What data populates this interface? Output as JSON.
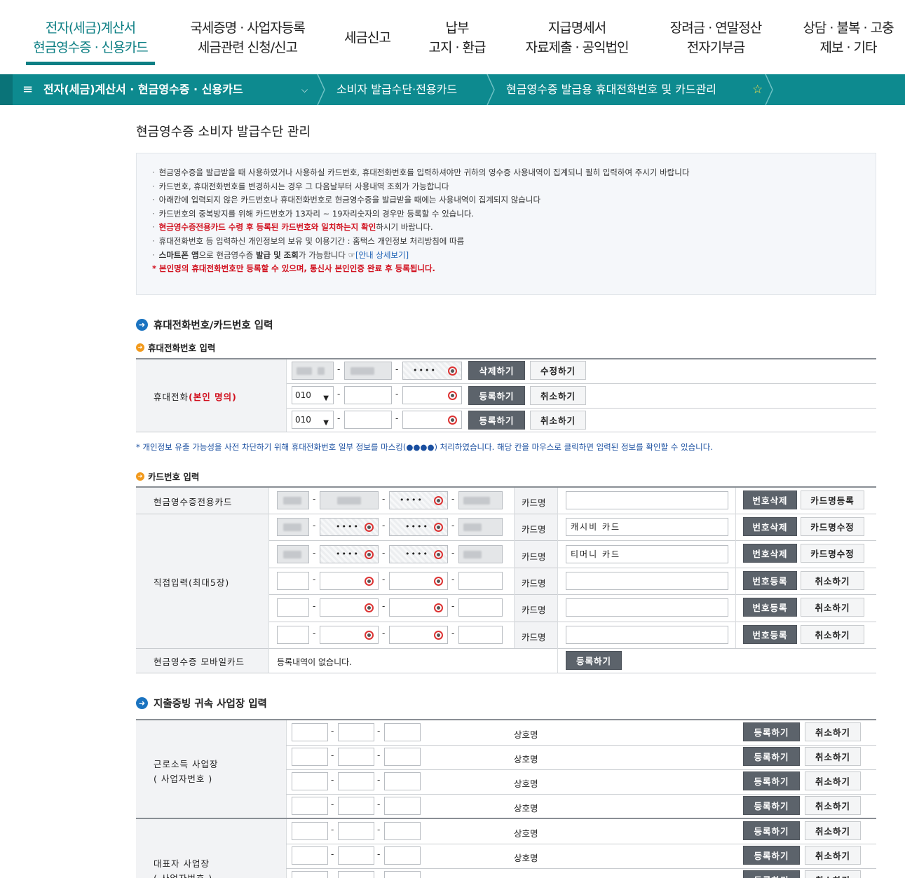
{
  "topnav": {
    "items": [
      {
        "line1": "전자(세금)계산서",
        "line2": "현금영수증 · 신용카드"
      },
      {
        "line1": "국세증명 · 사업자등록",
        "line2": "세금관련 신청/신고"
      },
      {
        "line1": "세금신고",
        "line2": ""
      },
      {
        "line1": "납부",
        "line2": "고지 · 환급"
      },
      {
        "line1": "지급명세서",
        "line2": "자료제출 · 공익법인"
      },
      {
        "line1": "장려금 · 연말정산",
        "line2": "전자기부금"
      },
      {
        "line1": "상담 · 불복 · 고충",
        "line2": "제보 · 기타"
      }
    ],
    "accent": "#0d7f84"
  },
  "breadcrumb": {
    "menu_icon": "≡",
    "level1": "전자(세금)계산서 · 현금영수증 · 신용카드",
    "level2": "소비자 발급수단·전용카드",
    "level3": "현금영수증 발급용 휴대전화번호 및 카드관리",
    "star": "☆",
    "bar_color": "#0d8a8f"
  },
  "page_title": "현금영수증 소비자 발급수단 관리",
  "notice": {
    "lines": [
      "현금영수증을 발급받을 때 사용하였거나 사용하실 카드번호, 휴대전화번호를 입력하셔야만 귀하의 영수증 사용내역이 집계되니 필히 입력하여 주시기 바랍니다",
      "카드번호, 휴대전화번호를 변경하시는 경우 그 다음날부터 사용내역 조회가 가능합니다",
      "아래칸에 입력되지 않은 카드번호나 휴대전화번호로 현금영수증을 발급받을 때에는 사용내역이 집계되지 않습니다",
      "카드번호의 중복방지를 위해 카드번호가 13자리 ~ 19자리숫자의 경우만 등록할 수 있습니다."
    ],
    "line5_red": "현금영수증전용카드 수령 후 등록된 카드번호와 일치하는지 확인",
    "line5_rest": "하시기 바랍니다.",
    "line6": "휴대전화번호 등 입력하신 개인정보의 보유 및 이용기간 : 홈택스 개인정보 처리방침에 따름",
    "line7_bold1": "스마트폰 앱",
    "line7_mid": "으로 현금영수증 ",
    "line7_bold2": "발급 및 조회",
    "line7_rest": "가 가능합니다 ☞",
    "line7_link": "[안내 상세보기]",
    "line8": "* 본인명의 휴대전화번호만 등록할 수 있으며, 통신사 본인인증 완료 후 등록됩니다."
  },
  "section1": {
    "title": "휴대전화번호/카드번호 입력",
    "phone_subtitle": "휴대전화번호 입력",
    "phone_label": "휴대전화",
    "phone_label_red": "(본인 명의)",
    "phone_prefix": "010",
    "phone_mask": "••••",
    "btn_delete": "삭제하기",
    "btn_edit": "수정하기",
    "btn_register": "등록하기",
    "btn_cancel": "취소하기",
    "hint": "* 개인정보 유출 가능성을 사전 차단하기 위해 휴대전화번호 일부 정보를 마스킹(●●●●) 처리하였습니다. 해당 칸을 마우스로 클릭하면 입력된 정보를 확인할 수 있습니다.",
    "card_subtitle": "카드번호 입력",
    "card_rows": {
      "dedicated_label": "현금영수증전용카드",
      "direct_label": "직접입력(최대5장)",
      "mobile_label": "현금영수증 모바일카드",
      "card_name_label": "카드명",
      "mask": "••••",
      "card1_name": "캐시비 카드",
      "card2_name": "티머니 카드",
      "btn_num_delete": "번호삭제",
      "btn_name_register": "카드명등록",
      "btn_name_edit": "카드명수정",
      "btn_num_register": "번호등록",
      "btn_cancel": "취소하기",
      "mobile_empty": "등록내역이 없습니다.",
      "btn_register": "등록하기"
    }
  },
  "section2": {
    "title": "지출증빙 귀속 사업장 입력",
    "earned_label1": "근로소득 사업장",
    "earned_label2": "( 사업자번호 )",
    "rep_label1": "대표자 사업장",
    "rep_label2": "( 사업자번호 )",
    "company_label": "상호명",
    "btn_register": "등록하기",
    "btn_cancel": "취소하기"
  }
}
